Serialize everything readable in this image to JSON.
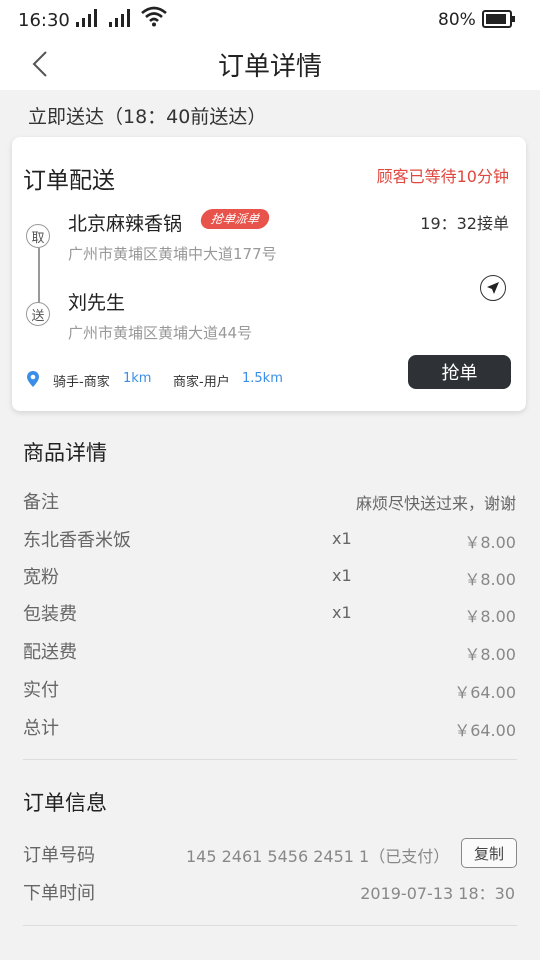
{
  "status_bar": {
    "time": "16:30",
    "battery": "80%"
  },
  "nav": {
    "title": "订单详情"
  },
  "delivery": {
    "text": "立即送达（18：40前送达）"
  },
  "order_card": {
    "title": "订单配送",
    "wait_text": "顾客已等待10分钟",
    "pickup_marker": "取",
    "dropoff_marker": "送",
    "shop_name": "北京麻辣香锅",
    "badge": "抢单派单",
    "accept_time": "19：32接单",
    "shop_address": "广州市黄埔区黄埔中大道177号",
    "customer_name": "刘先生",
    "customer_address": "广州市黄埔区黄埔大道44号",
    "rider_shop_label": "骑手-商家",
    "rider_shop_distance": "1km",
    "shop_user_label": "商家-用户",
    "shop_user_distance": "1.5km",
    "grab_button": "抢单"
  },
  "goods": {
    "title": "商品详情",
    "note_label": "备注",
    "note_value": "麻烦尽快送过来，谢谢",
    "items": [
      {
        "name": "东北香香米饭",
        "qty": "x1",
        "price": "￥8.00"
      },
      {
        "name": "宽粉",
        "qty": "x1",
        "price": "￥8.00"
      },
      {
        "name": "包装费",
        "qty": "x1",
        "price": "￥8.00"
      }
    ],
    "delivery_fee_label": "配送费",
    "delivery_fee": "￥8.00",
    "paid_label": "实付",
    "paid": "￥64.00",
    "total_label": "总计",
    "total": "￥64.00"
  },
  "order_info": {
    "title": "订单信息",
    "order_no_label": "订单号码",
    "order_no": "145 2461 5456 2451 1（已支付）",
    "copy_button": "复制",
    "order_time_label": "下单时间",
    "order_time": "2019-07-13 18：30"
  }
}
